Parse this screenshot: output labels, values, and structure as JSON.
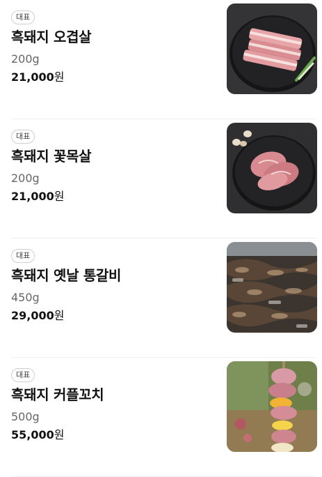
{
  "menu": {
    "items": [
      {
        "badge": "대표",
        "name": "흑돼지 오겹살",
        "weight": "200g",
        "price": "21,000",
        "currency": "원",
        "image_icon": "pork-belly-plate-image"
      },
      {
        "badge": "대표",
        "name": "흑돼지 꽃목살",
        "weight": "200g",
        "price": "21,000",
        "currency": "원",
        "image_icon": "pork-neck-plate-image"
      },
      {
        "badge": "대표",
        "name": "흑돼지 옛날 통갈비",
        "weight": "450g",
        "price": "29,000",
        "currency": "원",
        "image_icon": "grilled-ribs-image"
      },
      {
        "badge": "대표",
        "name": "흑돼지 커플꼬치",
        "weight": "500g",
        "price": "55,000",
        "currency": "원",
        "image_icon": "skewer-image"
      }
    ]
  }
}
